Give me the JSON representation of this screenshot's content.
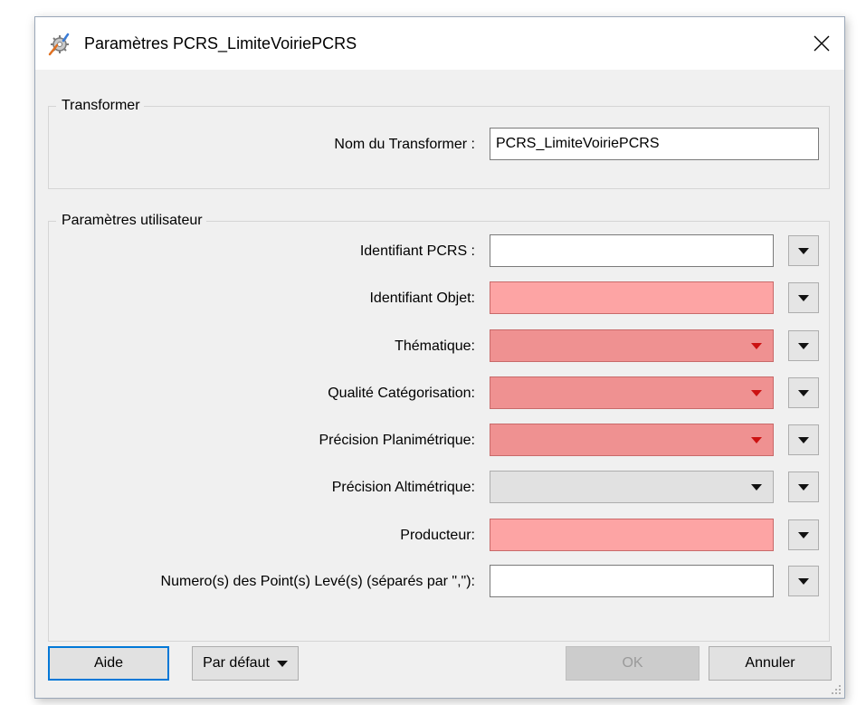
{
  "window": {
    "title": "Paramètres PCRS_LimiteVoiriePCRS",
    "icon": "transformer-gear-icon",
    "close_icon": "close-icon"
  },
  "transformer_group": {
    "title": "Transformer",
    "name_label": "Nom du Transformer :",
    "name_value": "PCRS_LimiteVoiriePCRS"
  },
  "params_group": {
    "title": "Paramètres utilisateur",
    "fields": [
      {
        "label": "Identifiant PCRS :",
        "type": "text",
        "value": "",
        "state": "normal"
      },
      {
        "label": "Identifiant Objet:",
        "type": "text",
        "value": "",
        "state": "required"
      },
      {
        "label": "Thématique:",
        "type": "dropdown",
        "value": "",
        "state": "required"
      },
      {
        "label": "Qualité Catégorisation:",
        "type": "dropdown",
        "value": "",
        "state": "required"
      },
      {
        "label": "Précision Planimétrique:",
        "type": "dropdown",
        "value": "",
        "state": "required"
      },
      {
        "label": "Précision Altimétrique:",
        "type": "dropdown",
        "value": "",
        "state": "normal"
      },
      {
        "label": "Producteur:",
        "type": "text",
        "value": "",
        "state": "required"
      },
      {
        "label": "Numero(s) des Point(s) Levé(s) (séparés par \",\"):",
        "type": "text",
        "value": "",
        "state": "normal"
      }
    ]
  },
  "buttons": {
    "help": "Aide",
    "defaults": "Par défaut",
    "ok": "OK",
    "cancel": "Annuler"
  },
  "colors": {
    "required_text": "#fda4a4",
    "required_dropdown": "#ef9191",
    "focus_border": "#0078d7",
    "dialog_bg": "#f0f0f0"
  }
}
